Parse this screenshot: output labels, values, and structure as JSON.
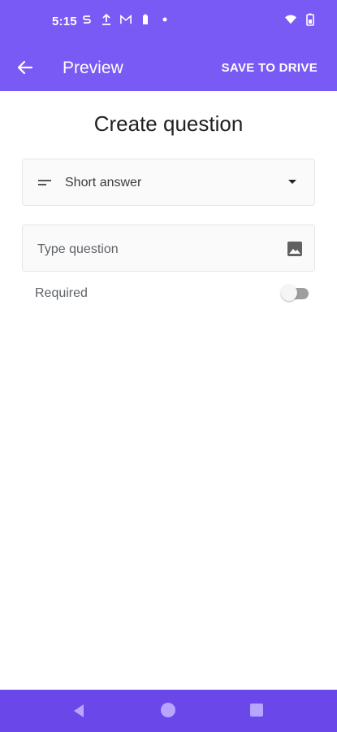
{
  "status": {
    "time": "5:15"
  },
  "toolbar": {
    "title": "Preview",
    "save_label": "SAVE TO DRIVE"
  },
  "page": {
    "title": "Create question"
  },
  "question_type": {
    "selected": "Short answer"
  },
  "question": {
    "placeholder": "Type question",
    "value": ""
  },
  "required": {
    "label": "Required",
    "enabled": false
  },
  "colors": {
    "accent": "#7a5af5",
    "navbar": "#6a47e8"
  }
}
